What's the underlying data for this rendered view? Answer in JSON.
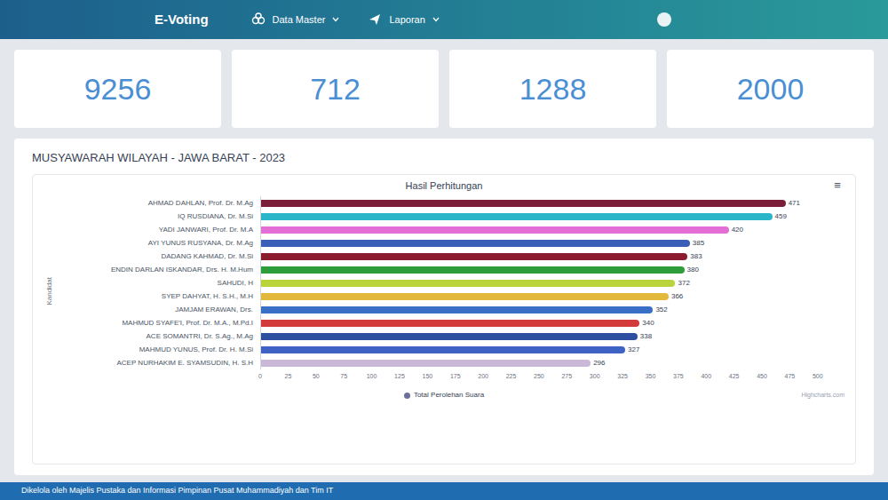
{
  "navbar": {
    "brand": "E-Voting",
    "menus": [
      {
        "label": "Data Master"
      },
      {
        "label": "Laporan"
      }
    ]
  },
  "stats": [
    {
      "value": "9256"
    },
    {
      "value": "712"
    },
    {
      "value": "1288"
    },
    {
      "value": "2000"
    }
  ],
  "card": {
    "title": "MUSYAWARAH WILAYAH - JAWA BARAT - 2023"
  },
  "chart": {
    "title": "Hasil Perhitungan",
    "menu_icon": "≡",
    "y_axis_title": "Kandidat",
    "x_axis_title": "",
    "x_ticks": [
      "0",
      "25",
      "50",
      "75",
      "100",
      "125",
      "150",
      "175",
      "200",
      "225",
      "250",
      "275",
      "300",
      "325",
      "350",
      "375",
      "400",
      "425",
      "450",
      "475",
      "500"
    ],
    "categories": [
      {
        "label": "AHMAD DAHLAN, Prof. Dr. M.Ag",
        "color": "#7b1e3a"
      },
      {
        "label": "IQ RUSDIANA, Dr. M.Si",
        "color": "#2bb5c8"
      },
      {
        "label": "YADI JANWARI, Prof. Dr. M.A",
        "color": "#e36fd6"
      },
      {
        "label": "AYI YUNUS RUSYANA, Dr. M.Ag",
        "color": "#3b5fb8"
      },
      {
        "label": "DADANG KAHMAD, Dr. M.Si",
        "color": "#8a1c2e"
      },
      {
        "label": "ENDIN DARLAN ISKANDAR, Drs. H. M.Hum",
        "color": "#2e9e3c"
      },
      {
        "label": "SAHUDI, H",
        "color": "#b8d43a"
      },
      {
        "label": "SYEP DAHYAT, H. S.H., M.H",
        "color": "#e2b93b"
      },
      {
        "label": "JAMJAM ERAWAN, Drs.",
        "color": "#3a6fc7"
      },
      {
        "label": "MAHMUD SYAFE'I, Prof. Dr. M.A., M.Pd.I",
        "color": "#d33b3b"
      },
      {
        "label": "ACE SOMANTRI, Dr. S.Ag., M.Ag",
        "color": "#2c4fa0"
      },
      {
        "label": "MAHMUD YUNUS, Prof. Dr. H. M.Si",
        "color": "#3f63c4"
      },
      {
        "label": "ACEP NURHAKIM E. SYAMSUDIN, H. S.H",
        "color": "#c9b8d8"
      }
    ],
    "series": [
      {
        "name": "Total Perolehan Suara",
        "values": [
          471,
          459,
          420,
          385,
          383,
          380,
          372,
          366,
          352,
          340,
          338,
          327,
          296
        ],
        "labels": [
          "471",
          "459",
          "420",
          "385",
          "383",
          "380",
          "372",
          "366",
          "352",
          "340",
          "338",
          "327",
          "296"
        ]
      }
    ],
    "credit": "Highcharts.com"
  },
  "footer": {
    "text": "Dikelola oleh Majelis Pustaka dan Informasi Pimpinan Pusat Muhammadiyah dan Tim IT"
  }
}
